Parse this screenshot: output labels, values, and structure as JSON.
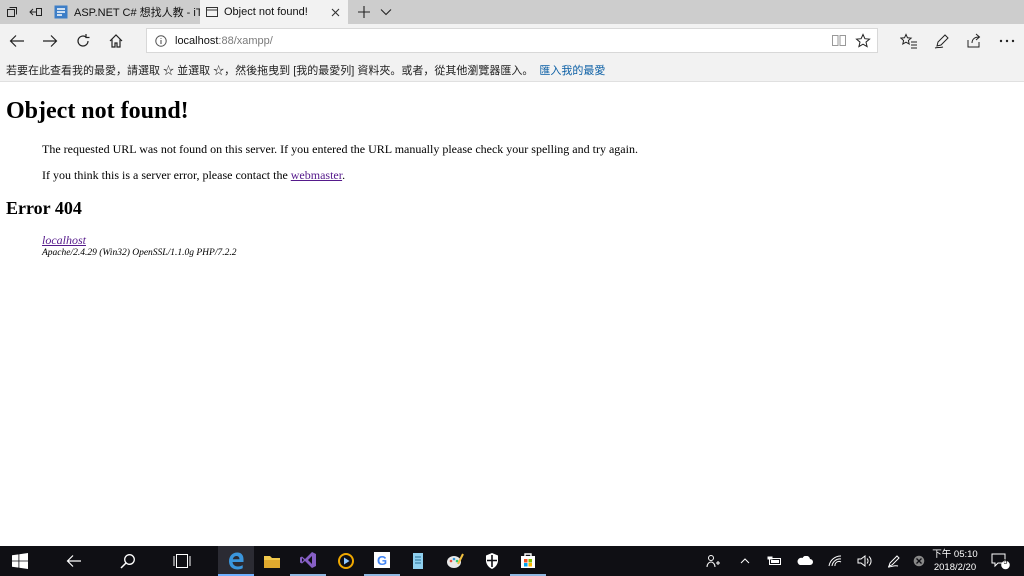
{
  "tabs": [
    {
      "title": "ASP.NET C# 想找人教 - iT 邦",
      "active": false
    },
    {
      "title": "Object not found!",
      "active": true
    }
  ],
  "address": {
    "host": "localhost",
    "rest": ":88/xampp/"
  },
  "favorites_bar": {
    "text": "若要在此查看我的最愛，請選取 ☆ 並選取 ☆，然後拖曳到 [我的最愛列] 資料夾。或者，從其他瀏覽器匯入。",
    "import_link": "匯入我的最愛"
  },
  "page": {
    "heading": "Object not found!",
    "p1": "The requested URL was not found on this server. If you entered the URL manually please check your spelling and try again.",
    "p2_prefix": "If you think this is a server error, please contact the ",
    "p2_link": "webmaster",
    "p2_suffix": ".",
    "error_heading": "Error 404",
    "host_link": "localhost",
    "server_signature": "Apache/2.4.29 (Win32) OpenSSL/1.1.0g PHP/7.2.2"
  },
  "taskbar": {
    "clock_time": "下午 05:10",
    "clock_date": "2018/2/20",
    "notification_count": "5",
    "apps": [
      "start-icon",
      "back-icon",
      "search-icon",
      "task-view-icon",
      "edge-icon",
      "file-explorer-icon",
      "visual-studio-icon",
      "media-player-icon",
      "chrome-icon",
      "notepad-icon",
      "paint-icon",
      "defender-icon",
      "store-icon"
    ]
  },
  "colors": {
    "accent": "#0b5fa5",
    "visited_link": "#551a8b",
    "taskbar": "#0f0f14"
  }
}
